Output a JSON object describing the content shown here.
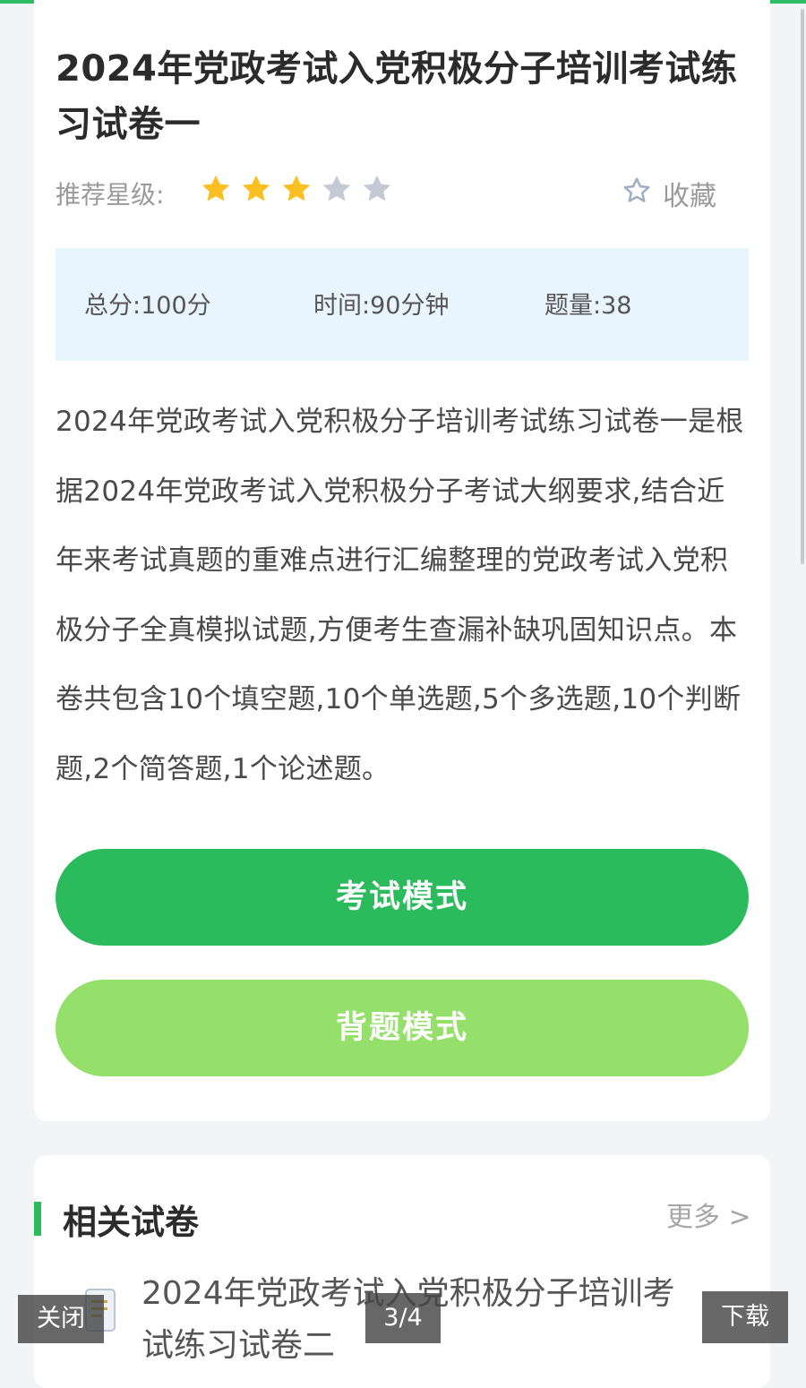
{
  "exam": {
    "title": "2024年党政考试入党积极分子培训考试练习试卷一",
    "rating_label": "推荐星级:",
    "rating": 3,
    "rating_max": 5,
    "favorite_label": "收藏",
    "total_score": "总分:100分",
    "time": "时间:90分钟",
    "question_count": "题量:38",
    "description": "2024年党政考试入党积极分子培训考试练习试卷一是根据2024年党政考试入党积极分子考试大纲要求,结合近年来考试真题的重难点进行汇编整理的党政考试入党积极分子全真模拟试题,方便考生查漏补缺巩固知识点。本卷共包含10个填空题,10个单选题,5个多选题,10个判断题,2个简答题,1个论述题。",
    "exam_mode_button": "考试模式",
    "recite_mode_button": "背题模式"
  },
  "related": {
    "title": "相关试卷",
    "more": "更多 >",
    "items": [
      {
        "title": "2024年党政考试入党积极分子培训考试练习试卷二"
      }
    ]
  },
  "viewer": {
    "close": "关闭",
    "page_indicator": "3/4",
    "download": "下载"
  },
  "colors": {
    "accent_green": "#2cbb5c",
    "light_green": "#95e06a",
    "star_filled": "#fbbf24",
    "star_empty": "#c3cad6",
    "info_bg": "#e8f4fe"
  },
  "icons": {
    "star": "star-icon",
    "favorite": "star-outline-icon",
    "document": "document-icon"
  }
}
